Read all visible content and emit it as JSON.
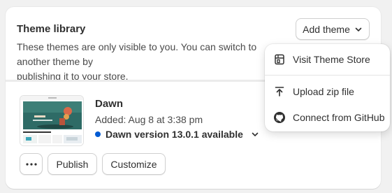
{
  "card": {
    "title": "Theme library",
    "description": "These themes are only visible to you. You can switch to another theme by\npublishing it to your store.",
    "add_theme_label": "Add theme"
  },
  "theme": {
    "name": "Dawn",
    "added": "Added: Aug 8 at 3:38 pm",
    "version_status": "Dawn version 13.0.1 available",
    "status_color": "#005bd3"
  },
  "actions": {
    "more_icon": "ellipsis-icon",
    "publish_label": "Publish",
    "customize_label": "Customize"
  },
  "dropdown": {
    "items": [
      {
        "label": "Visit Theme Store",
        "icon": "store-icon"
      },
      {
        "label": "Upload zip file",
        "icon": "upload-icon"
      },
      {
        "label": "Connect from GitHub",
        "icon": "github-icon"
      }
    ]
  }
}
